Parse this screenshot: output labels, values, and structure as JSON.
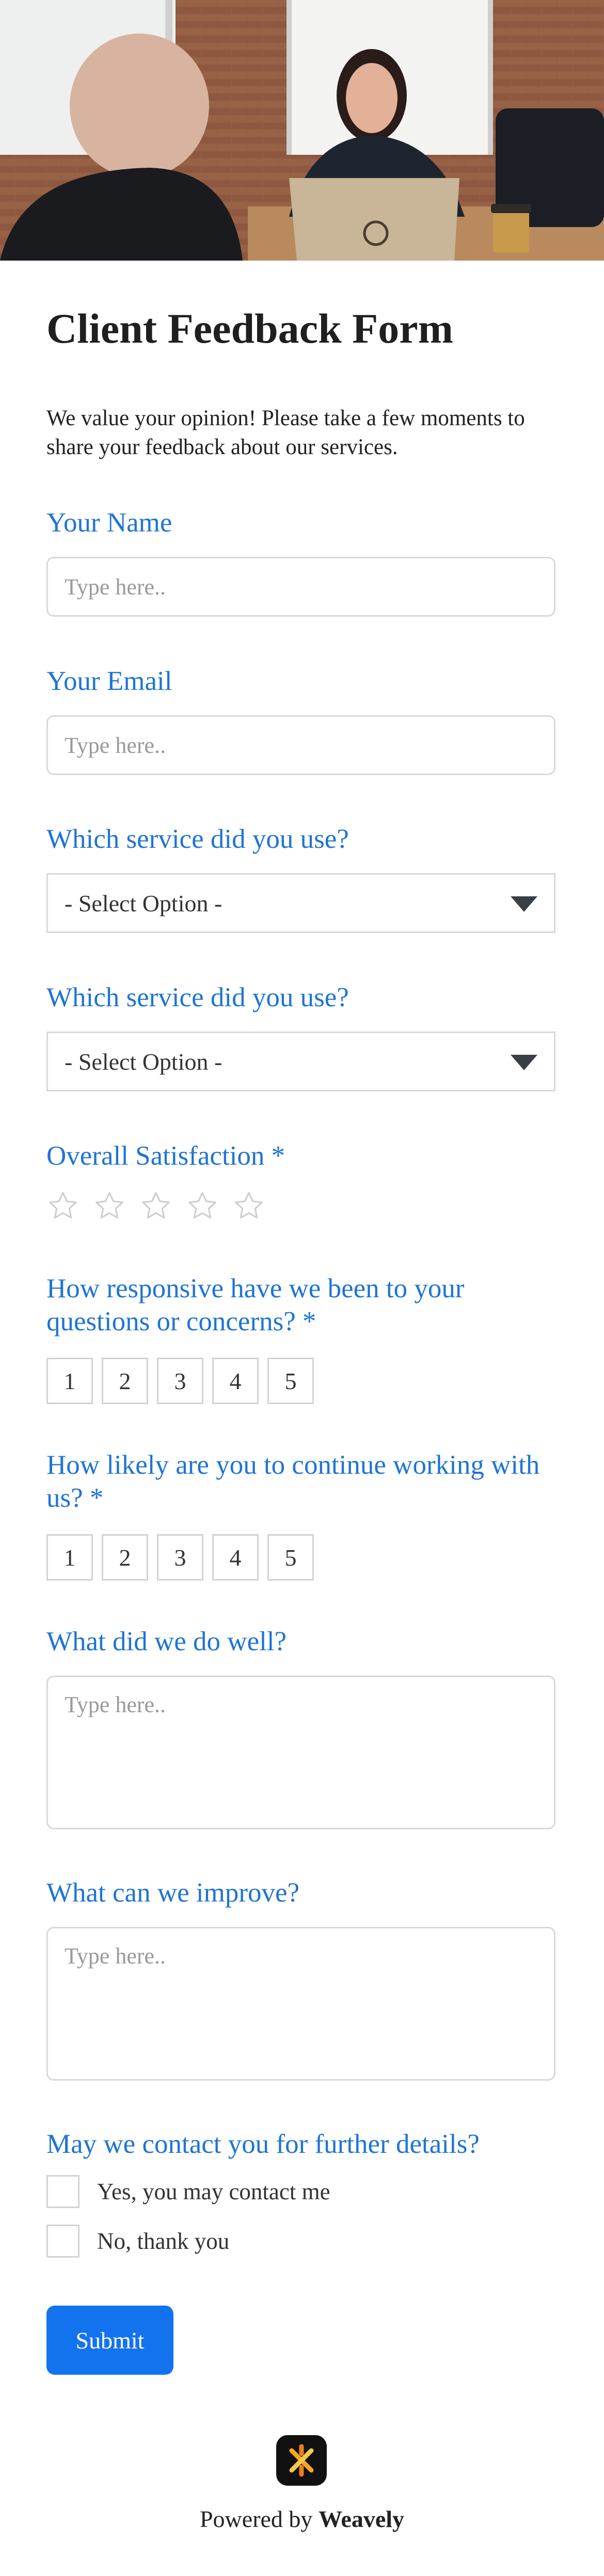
{
  "hero": {
    "alt": "hero-photo"
  },
  "form": {
    "title": "Client Feedback Form",
    "intro": "We value your opinion! Please take a few moments to share your feedback about our services.",
    "name_label": "Your Name",
    "name_placeholder": "Type here..",
    "email_label": "Your Email",
    "email_placeholder": "Type here..",
    "service1_label": "Which service did you use?",
    "service1_value": "- Select Option -",
    "service2_label": "Which service did you use?",
    "service2_value": "- Select Option -",
    "satisfaction_label": "Overall Satisfaction *",
    "satisfaction_rating": 0,
    "satisfaction_max": 5,
    "responsive_label": "How responsive have we been to your questions or concerns? *",
    "responsive_options": [
      "1",
      "2",
      "3",
      "4",
      "5"
    ],
    "likely_label": "How likely are you to continue working with us? *",
    "likely_options": [
      "1",
      "2",
      "3",
      "4",
      "5"
    ],
    "well_label": "What did we do well?",
    "well_placeholder": "Type here..",
    "improve_label": "What can we improve?",
    "improve_placeholder": "Type here..",
    "contact_label": "May we contact you for further details?",
    "contact_yes": "Yes, you may contact me",
    "contact_no": "No, thank you",
    "submit_label": "Submit"
  },
  "footer": {
    "powered_prefix": "Powered by ",
    "brand": "Weavely"
  },
  "colors": {
    "label": "#1e74d6",
    "submit": "#1373ef"
  }
}
